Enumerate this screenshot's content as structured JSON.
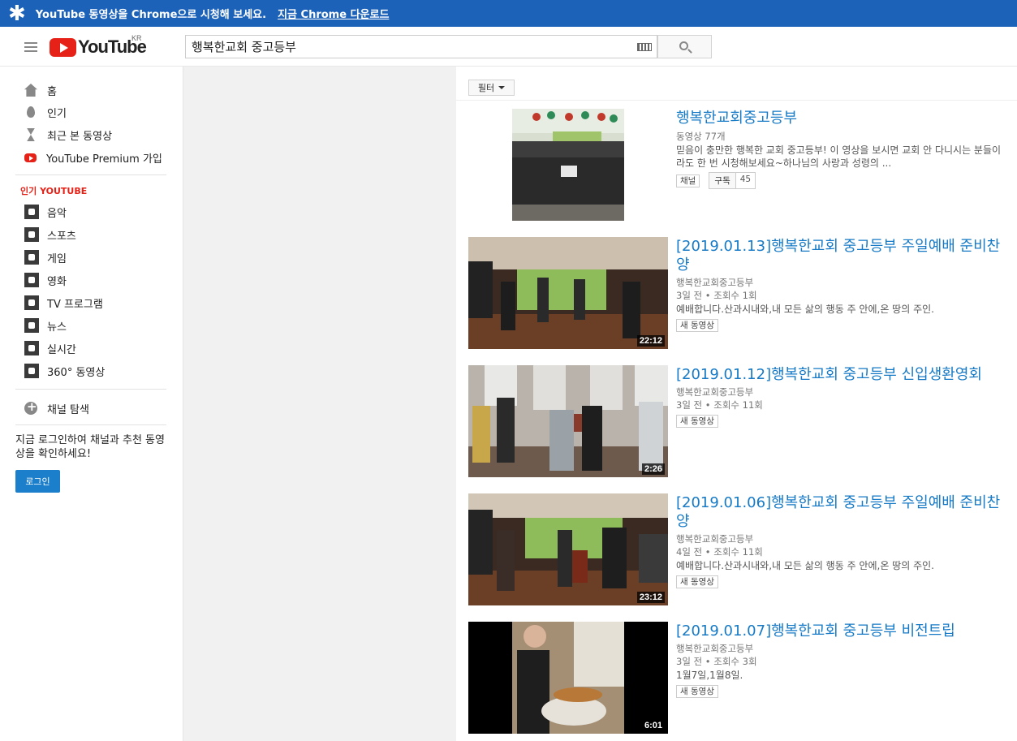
{
  "banner": {
    "message": "YouTube 동영상을 Chrome으로 시청해 보세요.",
    "link": "지금 Chrome 다운로드"
  },
  "header": {
    "logo_text": "YouTube",
    "region": "KR",
    "search_value": "행복한교회 중고등부"
  },
  "sidebar": {
    "main": [
      {
        "label": "홈",
        "icon": "home-icon"
      },
      {
        "label": "인기",
        "icon": "trending-icon"
      },
      {
        "label": "최근 본 동영상",
        "icon": "history-icon"
      },
      {
        "label": "YouTube Premium 가입",
        "icon": "youtube-premium-icon"
      }
    ],
    "section_title": "인기 YOUTUBE",
    "popular": [
      {
        "label": "음악",
        "icon": "music-icon"
      },
      {
        "label": "스포츠",
        "icon": "sports-icon"
      },
      {
        "label": "게임",
        "icon": "gaming-icon"
      },
      {
        "label": "영화",
        "icon": "movies-icon"
      },
      {
        "label": "TV 프로그램",
        "icon": "tv-icon"
      },
      {
        "label": "뉴스",
        "icon": "news-icon"
      },
      {
        "label": "실시간",
        "icon": "live-icon"
      },
      {
        "label": "360° 동영상",
        "icon": "vr-icon"
      }
    ],
    "browse": {
      "label": "채널 탐색",
      "icon": "plus-circle-icon"
    },
    "login_prompt": "지금 로그인하여 채널과 추천 동영상을 확인하세요!",
    "login_button": "로그인"
  },
  "filter": {
    "label": "필터"
  },
  "channel": {
    "name": "행복한교회중고등부",
    "video_count": "동영상 77개",
    "description": "믿음이 충만한 행복한 교회 중고등부! 이 영상을 보시면 교회 안 다니시는 분들이라도 한 번 시청해보세요~하나님의 사랑과 성령의 ...",
    "channel_badge": "채널",
    "subscribe_label": "구독",
    "subscriber_count": "45"
  },
  "videos": [
    {
      "title": "[2019.01.13]행복한교회 중고등부 주일예배 준비찬양",
      "channel": "행복한교회중고등부",
      "age": "3일 전",
      "views": "조회수 1회",
      "description": "예배합니다.산과시내와,내 모든 삶의 행동 주 안에,온 땅의 주인.",
      "badge": "새 동영상",
      "duration": "22:12"
    },
    {
      "title": "[2019.01.12]행복한교회 중고등부 신입생환영회",
      "channel": "행복한교회중고등부",
      "age": "3일 전",
      "views": "조회수 11회",
      "description": "",
      "badge": "새 동영상",
      "duration": "2:26"
    },
    {
      "title": "[2019.01.06]행복한교회 중고등부 주일예배 준비찬양",
      "channel": "행복한교회중고등부",
      "age": "4일 전",
      "views": "조회수 11회",
      "description": "예배합니다.산과시내와,내 모든 삶의 행동 주 안에,온 땅의 주인.",
      "badge": "새 동영상",
      "duration": "23:12"
    },
    {
      "title": "[2019.01.07]행복한교회 중고등부 비전트립",
      "channel": "행복한교회중고등부",
      "age": "3일 전",
      "views": "조회수 3회",
      "description": "1월7일,1월8일.",
      "badge": "새 동영상",
      "duration": "6:01"
    }
  ]
}
